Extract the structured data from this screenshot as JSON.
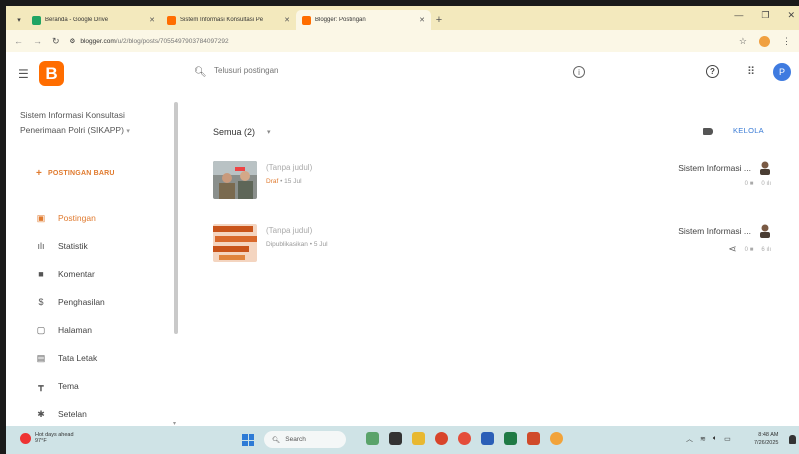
{
  "browser": {
    "tabs": [
      {
        "label": "Beranda - Google Drive",
        "favicon_color": "#1fa463"
      },
      {
        "label": "Sistem Informasi Konsultasi Pe",
        "favicon_color": "#ff6d00"
      },
      {
        "label": "Blogger: Postingan",
        "favicon_color": "#ff6d00",
        "active": true
      }
    ],
    "url_domain": "blogger.com",
    "url_path": "/u/2/blog/posts/7055497903784097292"
  },
  "header": {
    "logo_letter": "B",
    "search_placeholder": "Telusuri postingan",
    "avatar_letter": "P",
    "help_glyph": "?",
    "info_glyph": "i"
  },
  "sidebar": {
    "blog_name": "Sistem Informasi Konsultasi Penerimaan Polri (SIKAPP)",
    "new_post_label": "POSTINGAN BARU",
    "items": [
      {
        "label": "Postingan",
        "icon": "posts-icon",
        "active": true
      },
      {
        "label": "Statistik",
        "icon": "stats-icon"
      },
      {
        "label": "Komentar",
        "icon": "comment-icon"
      },
      {
        "label": "Penghasilan",
        "icon": "dollar-icon"
      },
      {
        "label": "Halaman",
        "icon": "page-icon"
      },
      {
        "label": "Tata Letak",
        "icon": "layout-icon"
      },
      {
        "label": "Tema",
        "icon": "theme-icon"
      },
      {
        "label": "Setelan",
        "icon": "settings-icon"
      }
    ]
  },
  "main": {
    "filter_label": "Semua (2)",
    "manage_label": "KELOLA",
    "posts": [
      {
        "title": "(Tanpa judul)",
        "status": "Draf",
        "date": "15 Jul",
        "author": "Sistem Informasi ...",
        "comments": "0",
        "views": "0"
      },
      {
        "title": "(Tanpa judul)",
        "status": "Dipublikasikan",
        "date": "5 Jul",
        "author": "Sistem Informasi ...",
        "comments": "0",
        "views": "6"
      }
    ]
  },
  "taskbar": {
    "weather_title": "Hot days ahead",
    "weather_temp": "97°F",
    "search_label": "Search",
    "time": "8:48 AM",
    "date": "7/26/2025"
  }
}
